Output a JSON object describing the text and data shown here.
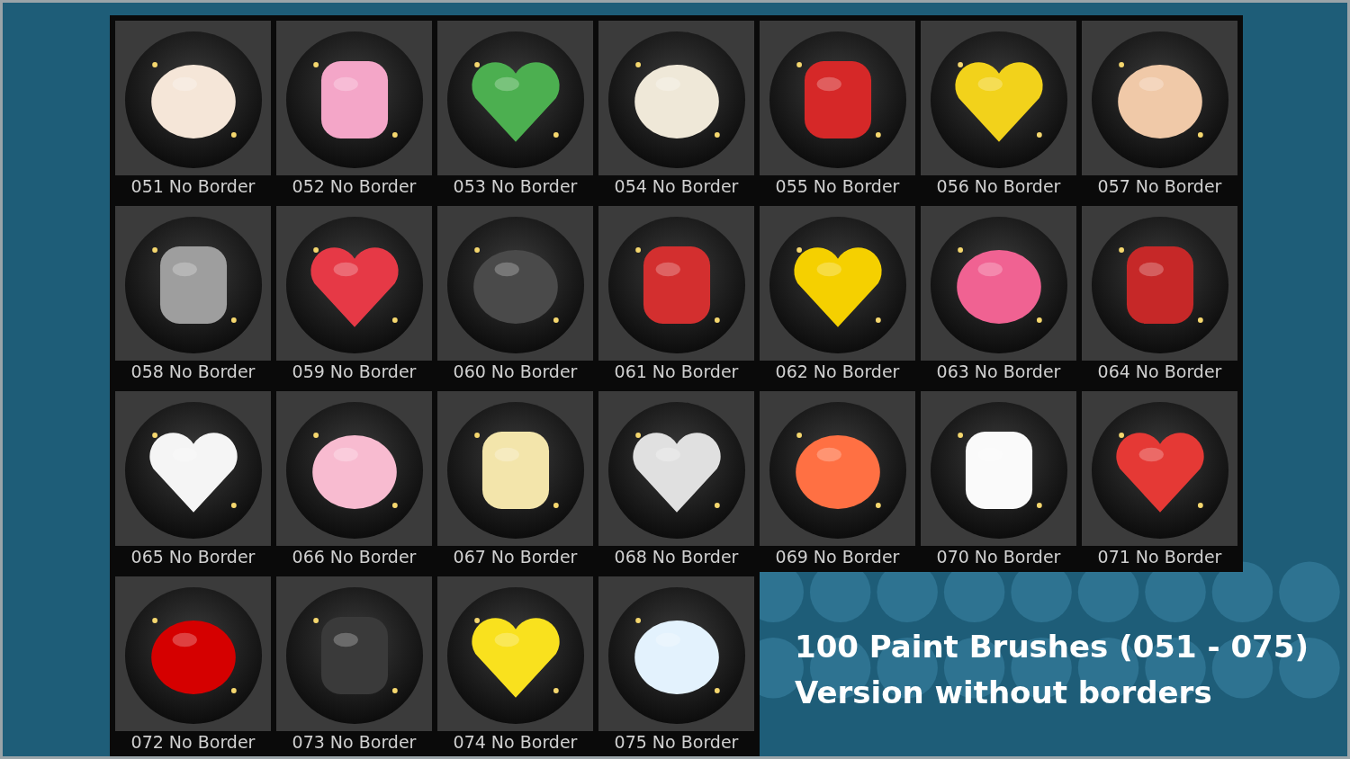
{
  "brushes": [
    {
      "label": "051 No Border"
    },
    {
      "label": "052 No Border"
    },
    {
      "label": "053 No Border"
    },
    {
      "label": "054 No Border"
    },
    {
      "label": "055 No Border"
    },
    {
      "label": "056 No Border"
    },
    {
      "label": "057 No Border"
    },
    {
      "label": "058 No Border"
    },
    {
      "label": "059 No Border"
    },
    {
      "label": "060 No Border"
    },
    {
      "label": "061 No Border"
    },
    {
      "label": "062 No Border"
    },
    {
      "label": "063 No Border"
    },
    {
      "label": "064 No Border"
    },
    {
      "label": "065 No Border"
    },
    {
      "label": "066 No Border"
    },
    {
      "label": "067 No Border"
    },
    {
      "label": "068 No Border"
    },
    {
      "label": "069 No Border"
    },
    {
      "label": "070 No Border"
    },
    {
      "label": "071 No Border"
    },
    {
      "label": "072 No Border"
    },
    {
      "label": "073 No Border"
    },
    {
      "label": "074 No Border"
    },
    {
      "label": "075 No Border"
    }
  ],
  "caption": {
    "title": "100 Paint Brushes (051 - 075)",
    "subtitle": "Version without borders"
  }
}
